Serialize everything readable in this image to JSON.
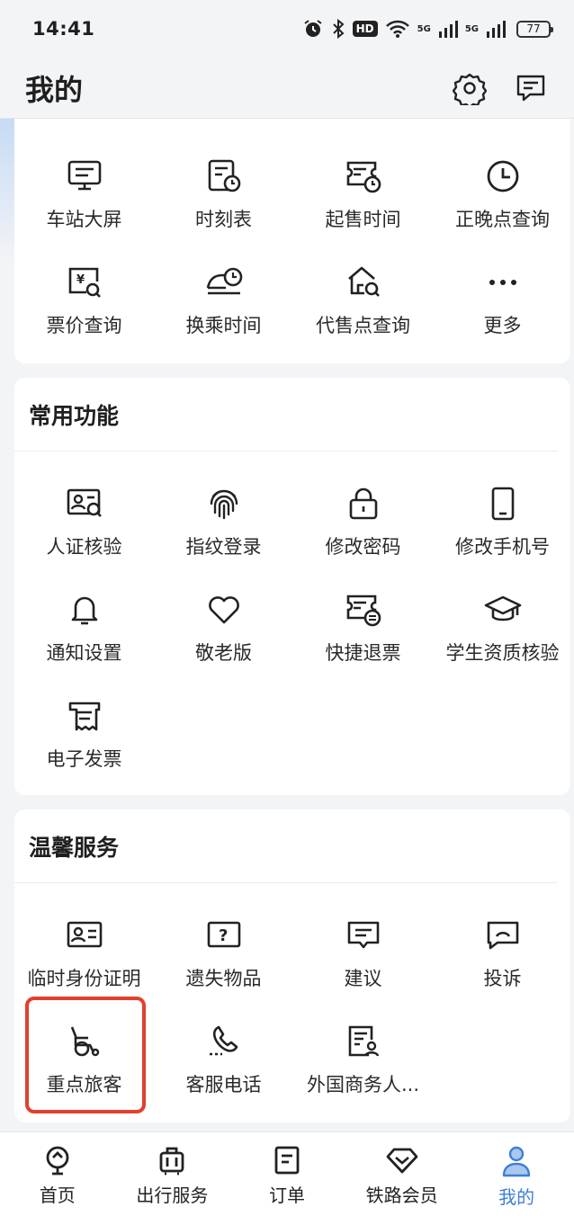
{
  "status_bar": {
    "time": "14:41",
    "hd_label": "HD",
    "signal_label_1": "5G",
    "signal_label_2": "5G",
    "battery": "77"
  },
  "header": {
    "title": "我的",
    "settings_icon": "gear-icon",
    "message_icon": "message-icon"
  },
  "travel_tools": {
    "items": [
      {
        "label": "车站大屏",
        "icon": "monitor-icon"
      },
      {
        "label": "时刻表",
        "icon": "timetable-icon"
      },
      {
        "label": "起售时间",
        "icon": "ticket-clock-icon"
      },
      {
        "label": "正晚点查询",
        "icon": "clock-icon"
      },
      {
        "label": "票价查询",
        "icon": "price-search-icon"
      },
      {
        "label": "换乘时间",
        "icon": "transfer-icon"
      },
      {
        "label": "代售点查询",
        "icon": "agency-search-icon"
      },
      {
        "label": "更多",
        "icon": "more-icon"
      }
    ]
  },
  "common_functions": {
    "title": "常用功能",
    "items": [
      {
        "label": "人证核验",
        "icon": "id-verify-icon"
      },
      {
        "label": "指纹登录",
        "icon": "fingerprint-icon"
      },
      {
        "label": "修改密码",
        "icon": "lock-icon"
      },
      {
        "label": "修改手机号",
        "icon": "phone-icon"
      },
      {
        "label": "通知设置",
        "icon": "bell-icon"
      },
      {
        "label": "敬老版",
        "icon": "heart-icon"
      },
      {
        "label": "快捷退票",
        "icon": "refund-ticket-icon"
      },
      {
        "label": "学生资质核验",
        "icon": "graduation-cap-icon"
      },
      {
        "label": "电子发票",
        "icon": "invoice-icon"
      }
    ]
  },
  "warm_services": {
    "title": "温馨服务",
    "items": [
      {
        "label": "临时身份证明",
        "icon": "temp-id-icon"
      },
      {
        "label": "遗失物品",
        "icon": "lost-item-icon"
      },
      {
        "label": "建议",
        "icon": "suggestion-icon"
      },
      {
        "label": "投诉",
        "icon": "complaint-icon"
      },
      {
        "label": "重点旅客",
        "icon": "wheelchair-icon"
      },
      {
        "label": "客服电话",
        "icon": "phone-call-icon"
      },
      {
        "label": "外国商务人...",
        "icon": "foreign-business-icon"
      }
    ]
  },
  "bottom_nav": {
    "items": [
      {
        "label": "首页",
        "icon": "home-train-icon"
      },
      {
        "label": "出行服务",
        "icon": "luggage-icon"
      },
      {
        "label": "订单",
        "icon": "order-icon"
      },
      {
        "label": "铁路会员",
        "icon": "diamond-icon"
      },
      {
        "label": "我的",
        "icon": "user-icon",
        "active": true
      }
    ]
  },
  "colors": {
    "accent": "#3d7fd6",
    "highlight": "#e2402b",
    "background": "#f3f4f6"
  }
}
